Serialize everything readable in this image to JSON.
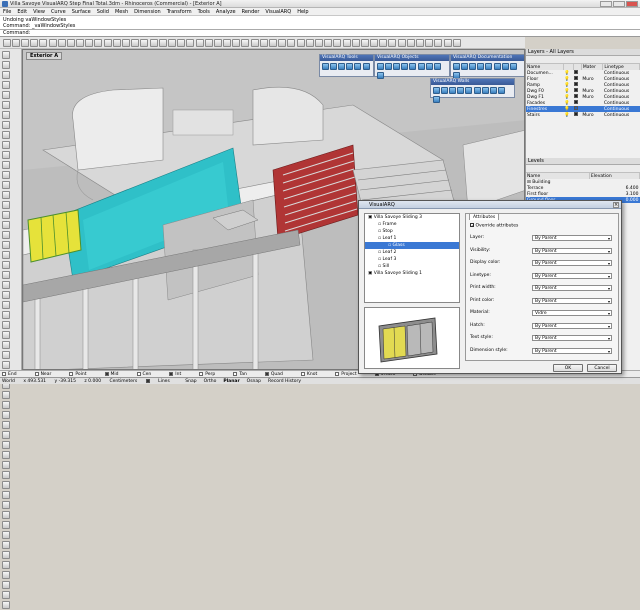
{
  "title_bar": {
    "text": "Villa Savoye VisualARQ Step Final Total.3dm - Rhinoceros (Commercial) - [Exterior A]"
  },
  "menu": [
    "File",
    "Edit",
    "View",
    "Curve",
    "Surface",
    "Solid",
    "Mesh",
    "Dimension",
    "Transform",
    "Tools",
    "Analyze",
    "Render",
    "VisualARQ",
    "Help"
  ],
  "command_history": [
    "Undoing vaWindowStyles",
    "Command: _vaWindowStyles"
  ],
  "command_prompt": "Command:",
  "viewport": {
    "label": "Exterior A"
  },
  "floating_toolbars": {
    "tools": "VisualARQ Tools",
    "objects": "VisualARQ Objects",
    "documentation": "VisualARQ Documentation",
    "walls": "VisualARQ Walls"
  },
  "layers_panel": {
    "title": "Layers - All Layers",
    "columns": [
      "Name",
      "",
      "",
      "Mater",
      "Linetype"
    ],
    "rows": [
      {
        "name": "Documen...",
        "color": "#222222",
        "material": "",
        "linetype": "Continuous",
        "selected": false
      },
      {
        "name": "Floor",
        "color": "#222222",
        "material": "Muro",
        "linetype": "Continuous",
        "selected": false
      },
      {
        "name": "Ramp",
        "color": "#222222",
        "material": "",
        "linetype": "Continuous",
        "selected": false
      },
      {
        "name": "Dwg F0",
        "color": "#222222",
        "material": "Muro",
        "linetype": "Continuous",
        "selected": false
      },
      {
        "name": "Dwg F1",
        "color": "#222222",
        "material": "Muro",
        "linetype": "Continuous",
        "selected": false
      },
      {
        "name": "Facades",
        "color": "#222222",
        "material": "",
        "linetype": "Continuous",
        "selected": false
      },
      {
        "name": "Finestres",
        "color": "#1e5fbf",
        "material": "",
        "linetype": "Continuous",
        "selected": true
      },
      {
        "name": "Stairs",
        "color": "#222222",
        "material": "Muro",
        "linetype": "Continuous",
        "selected": false
      }
    ]
  },
  "levels_panel": {
    "title": "Levels",
    "columns": [
      "Name",
      "Elevation"
    ],
    "rows": [
      {
        "name": "Building",
        "elevation": "",
        "selected": false
      },
      {
        "name": "Terrace",
        "elevation": "6.400",
        "selected": false
      },
      {
        "name": "First floor",
        "elevation": "3.100",
        "selected": false
      },
      {
        "name": "Ground floor",
        "elevation": "0.000",
        "selected": true
      }
    ]
  },
  "dialog": {
    "title": "VisualARQ",
    "tree": [
      {
        "label": "Villa Savoye Sliding 3",
        "indent": 0,
        "selected": false
      },
      {
        "label": "Frame",
        "indent": 1,
        "selected": false
      },
      {
        "label": "Stop",
        "indent": 1,
        "selected": false
      },
      {
        "label": "Leaf 1",
        "indent": 1,
        "selected": false
      },
      {
        "label": "Glass",
        "indent": 2,
        "selected": true
      },
      {
        "label": "Leaf 2",
        "indent": 1,
        "selected": false
      },
      {
        "label": "Leaf 3",
        "indent": 1,
        "selected": false
      },
      {
        "label": "Sill",
        "indent": 1,
        "selected": false
      },
      {
        "label": "Villa Savoye Sliding 1",
        "indent": 0,
        "selected": false
      }
    ],
    "attributes_tab": "Attributes",
    "override_label": "Override attributes",
    "attributes": [
      {
        "label": "Layer:",
        "value": "By Parent"
      },
      {
        "label": "Visibility:",
        "value": "By Parent"
      },
      {
        "label": "Display color:",
        "value": "By Parent"
      },
      {
        "label": "Linetype:",
        "value": "By Parent"
      },
      {
        "label": "Print width:",
        "value": "By Parent"
      },
      {
        "label": "Print color:",
        "value": "By Parent"
      },
      {
        "label": "Material:",
        "value": "Vidre"
      },
      {
        "label": "Hatch:",
        "value": "By Parent"
      },
      {
        "label": "Text style:",
        "value": "By Parent"
      },
      {
        "label": "Dimension style:",
        "value": "By Parent"
      }
    ],
    "ok_label": "OK",
    "cancel_label": "Cancel"
  },
  "osnaps": [
    {
      "label": "End",
      "checked": false
    },
    {
      "label": "Near",
      "checked": false
    },
    {
      "label": "Point",
      "checked": false
    },
    {
      "label": "Mid",
      "checked": true
    },
    {
      "label": "Cen",
      "checked": false
    },
    {
      "label": "Int",
      "checked": true
    },
    {
      "label": "Perp",
      "checked": false
    },
    {
      "label": "Tan",
      "checked": false
    },
    {
      "label": "Quad",
      "checked": true
    },
    {
      "label": "Knot",
      "checked": false
    },
    {
      "label": "Project",
      "checked": false
    },
    {
      "label": "STrack",
      "checked": true
    },
    {
      "label": "Disable",
      "checked": false
    }
  ],
  "status": {
    "cplane": "World",
    "x": "x 493.531",
    "y": "y -39.315",
    "z": "z 0.000",
    "units": "Centimeters",
    "layer": "Lines",
    "toggles": [
      "Snap",
      "Ortho",
      "Planar",
      "Osnap",
      "Record History"
    ]
  },
  "colors": {
    "glass_cyan": "#2fc0c8",
    "accent_blue": "#3a78d4"
  }
}
